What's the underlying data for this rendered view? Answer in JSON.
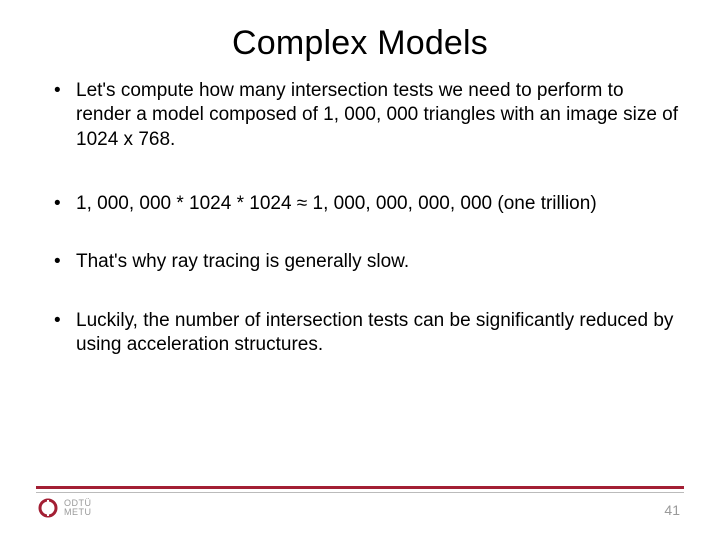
{
  "title": "Complex Models",
  "bullets": [
    "Let's compute how many intersection tests we need to perform to render a model composed of 1, 000, 000 triangles with an image size of 1024 x 768.",
    "1, 000, 000 * 1024 * 1024 ≈ 1, 000, 000, 000, 000 (one trillion)",
    "That's why ray tracing is generally slow.",
    "Luckily, the number of intersection tests can be significantly reduced by using acceleration structures."
  ],
  "footer": {
    "logo_line1": "ODTÜ",
    "logo_line2": "METU",
    "page_number": "41"
  }
}
